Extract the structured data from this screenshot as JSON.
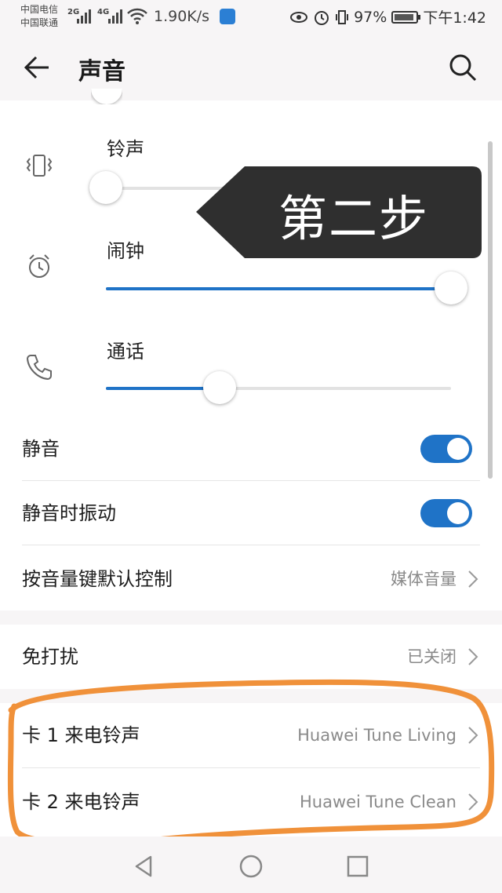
{
  "status_bar": {
    "carrier1": "中国电信",
    "carrier2": "中国联通",
    "net1": "2G",
    "net2": "4G",
    "speed": "1.90K/s",
    "battery": "97%",
    "time": "下午1:42"
  },
  "toolbar": {
    "title": "声音",
    "back_icon": "arrow-left-icon",
    "search_icon": "search-icon"
  },
  "sliders": [
    {
      "label": "铃声",
      "icon": "vibrate-icon",
      "level": 0.0
    },
    {
      "label": "闹钟",
      "icon": "alarm-icon",
      "level": 1.0
    },
    {
      "label": "通话",
      "icon": "phone-icon",
      "level": 0.33
    }
  ],
  "toggles": [
    {
      "label": "静音",
      "on": true
    },
    {
      "label": "静音时振动",
      "on": true
    }
  ],
  "volume_key": {
    "label": "按音量键默认控制",
    "value": "媒体音量"
  },
  "dnd": {
    "label": "免打扰",
    "value": "已关闭"
  },
  "ringtones": [
    {
      "label": "卡 1 来电铃声",
      "value": "Huawei Tune Living"
    },
    {
      "label": "卡 2 来电铃声",
      "value": "Huawei Tune Clean"
    }
  ],
  "callout": {
    "text": "第二步"
  },
  "colors": {
    "accent": "#1f73c7",
    "annotation": "#f0913a",
    "callout_bg": "#2f2f2f"
  }
}
